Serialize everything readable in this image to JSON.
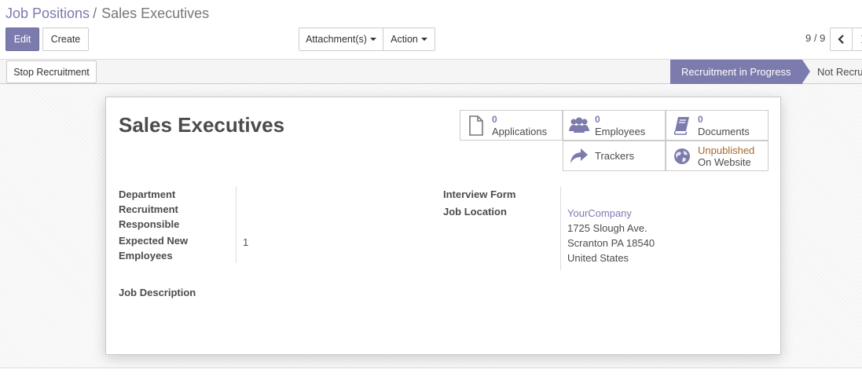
{
  "breadcrumb": {
    "parent": "Job Positions",
    "separator": "/",
    "current": "Sales Executives"
  },
  "toolbar": {
    "edit_label": "Edit",
    "create_label": "Create",
    "attachments_label": "Attachment(s)",
    "action_label": "Action"
  },
  "pager": {
    "value": "9 / 9"
  },
  "statusbar": {
    "stop_label": "Stop Recruitment",
    "active_stage": "Recruitment in Progress",
    "next_stage": "Not Recruiting"
  },
  "form": {
    "title": "Sales Executives",
    "smart_buttons": {
      "applications": {
        "count": "0",
        "label": "Applications"
      },
      "employees": {
        "count": "0",
        "label": "Employees"
      },
      "documents": {
        "count": "0",
        "label": "Documents"
      },
      "trackers": {
        "label": "Trackers"
      },
      "website": {
        "status": "Unpublished",
        "label": "On Website"
      }
    },
    "fields": {
      "department_label": "Department",
      "recruitment_responsible_label_1": "Recruitment",
      "recruitment_responsible_label_2": "Responsible",
      "expected_employees_label_1": "Expected New",
      "expected_employees_label_2": "Employees",
      "expected_employees_value": "1",
      "interview_form_label": "Interview Form",
      "job_location_label": "Job Location",
      "job_location_company": "YourCompany",
      "job_location_street": "1725 Slough Ave.",
      "job_location_city": "Scranton PA 18540",
      "job_location_country": "United States",
      "job_description_label": "Job Description"
    }
  },
  "colors": {
    "brand": "#7c7bad",
    "unpublished": "#a46a2f",
    "text": "#4c4c4c"
  }
}
